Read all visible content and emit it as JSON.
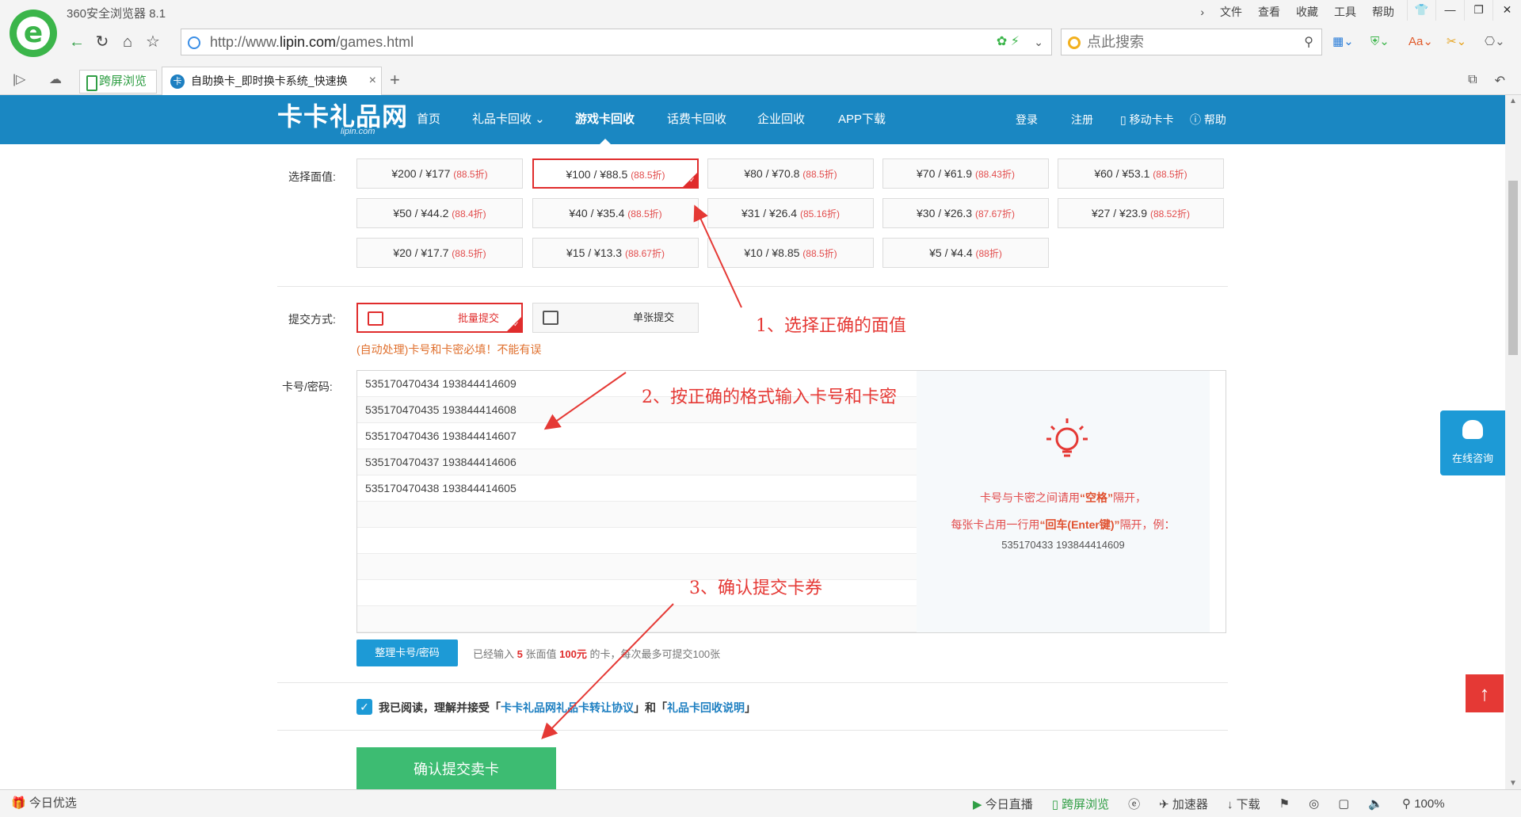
{
  "browser": {
    "title": "360安全浏览器 8.1",
    "menu": [
      "文件",
      "查看",
      "收藏",
      "工具",
      "帮助"
    ],
    "url_prefix": "http://www.",
    "url_domain": "lipin.com",
    "url_path": "/games.html",
    "search_placeholder": "点此搜索",
    "tabs": {
      "cross_screen": "跨屏浏览",
      "active_title": "自助换卡_即时换卡系统_快速换",
      "active_favicon": "卡"
    }
  },
  "site": {
    "logo": "卡卡礼品网",
    "logo_sub": "lipin.com",
    "nav": [
      "首页",
      "礼品卡回收 ⌄",
      "游戏卡回收",
      "话费卡回收",
      "企业回收",
      "APP下载"
    ],
    "nav_right": [
      "登录",
      "注册",
      "移动卡卡",
      "帮助"
    ]
  },
  "form": {
    "face_label": "选择面值:",
    "faces": [
      {
        "value": "¥200 / ¥177",
        "discount": "(88.5折)"
      },
      {
        "value": "¥100 / ¥88.5",
        "discount": "(88.5折)"
      },
      {
        "value": "¥80 / ¥70.8",
        "discount": "(88.5折)"
      },
      {
        "value": "¥70 / ¥61.9",
        "discount": "(88.43折)"
      },
      {
        "value": "¥60 / ¥53.1",
        "discount": "(88.5折)"
      },
      {
        "value": "¥50 / ¥44.2",
        "discount": "(88.4折)"
      },
      {
        "value": "¥40 / ¥35.4",
        "discount": "(88.5折)"
      },
      {
        "value": "¥31 / ¥26.4",
        "discount": "(85.16折)"
      },
      {
        "value": "¥30 / ¥26.3",
        "discount": "(87.67折)"
      },
      {
        "value": "¥27 / ¥23.9",
        "discount": "(88.52折)"
      },
      {
        "value": "¥20 / ¥17.7",
        "discount": "(88.5折)"
      },
      {
        "value": "¥15 / ¥13.3",
        "discount": "(88.67折)"
      },
      {
        "value": "¥10 / ¥8.85",
        "discount": "(88.5折)"
      },
      {
        "value": "¥5 / ¥4.4",
        "discount": "(88折)"
      }
    ],
    "selected_face_index": 1,
    "method_label": "提交方式:",
    "method_batch": "批量提交",
    "method_single": "单张提交",
    "method_warning": "(自动处理)卡号和卡密必填！不能有误",
    "cards_label": "卡号/密码:",
    "cards": [
      "535170470434 193844414609",
      "535170470435 193844414608",
      "535170470436 193844414607",
      "535170470437 193844414606",
      "535170470438 193844414605"
    ],
    "hint_line1_pre": "卡号与卡密之间请用",
    "hint_line1_key": "“空格”",
    "hint_line1_post": "隔开，",
    "hint_line2_pre": "每张卡占用一行用",
    "hint_line2_key": "“回车(Enter键)”",
    "hint_line2_post": "隔开，例：",
    "hint_example": "535170433 193844414609",
    "tidy_button": "整理卡号/密码",
    "count_pre": "已经输入",
    "count_num": "5",
    "count_mid": "张面值",
    "count_amount": "100元",
    "count_post": "的卡，每次最多可提交100张",
    "agree_pre": "我已阅读，理解并接受「",
    "agree_link1": "卡卡礼品网礼品卡转让协议",
    "agree_mid": "」和「",
    "agree_link2": "礼品卡回收说明",
    "agree_post": "」",
    "submit_button": "确认提交卖卡"
  },
  "annotations": {
    "step1": "1、选择正确的面值",
    "step2": "2、按正确的格式输入卡号和卡密",
    "step3": "3、确认提交卡券"
  },
  "floating": {
    "consult": "在线咨询",
    "back_top": "↑"
  },
  "status": {
    "left": "今日优选",
    "items": [
      "今日直播",
      "跨屏浏览",
      "加速器",
      "下载",
      "100%"
    ]
  },
  "colors": {
    "header_blue": "#1a87c2",
    "select_red": "#e02c2c",
    "submit_green": "#3dbc72",
    "annotation_red": "#e53935"
  }
}
